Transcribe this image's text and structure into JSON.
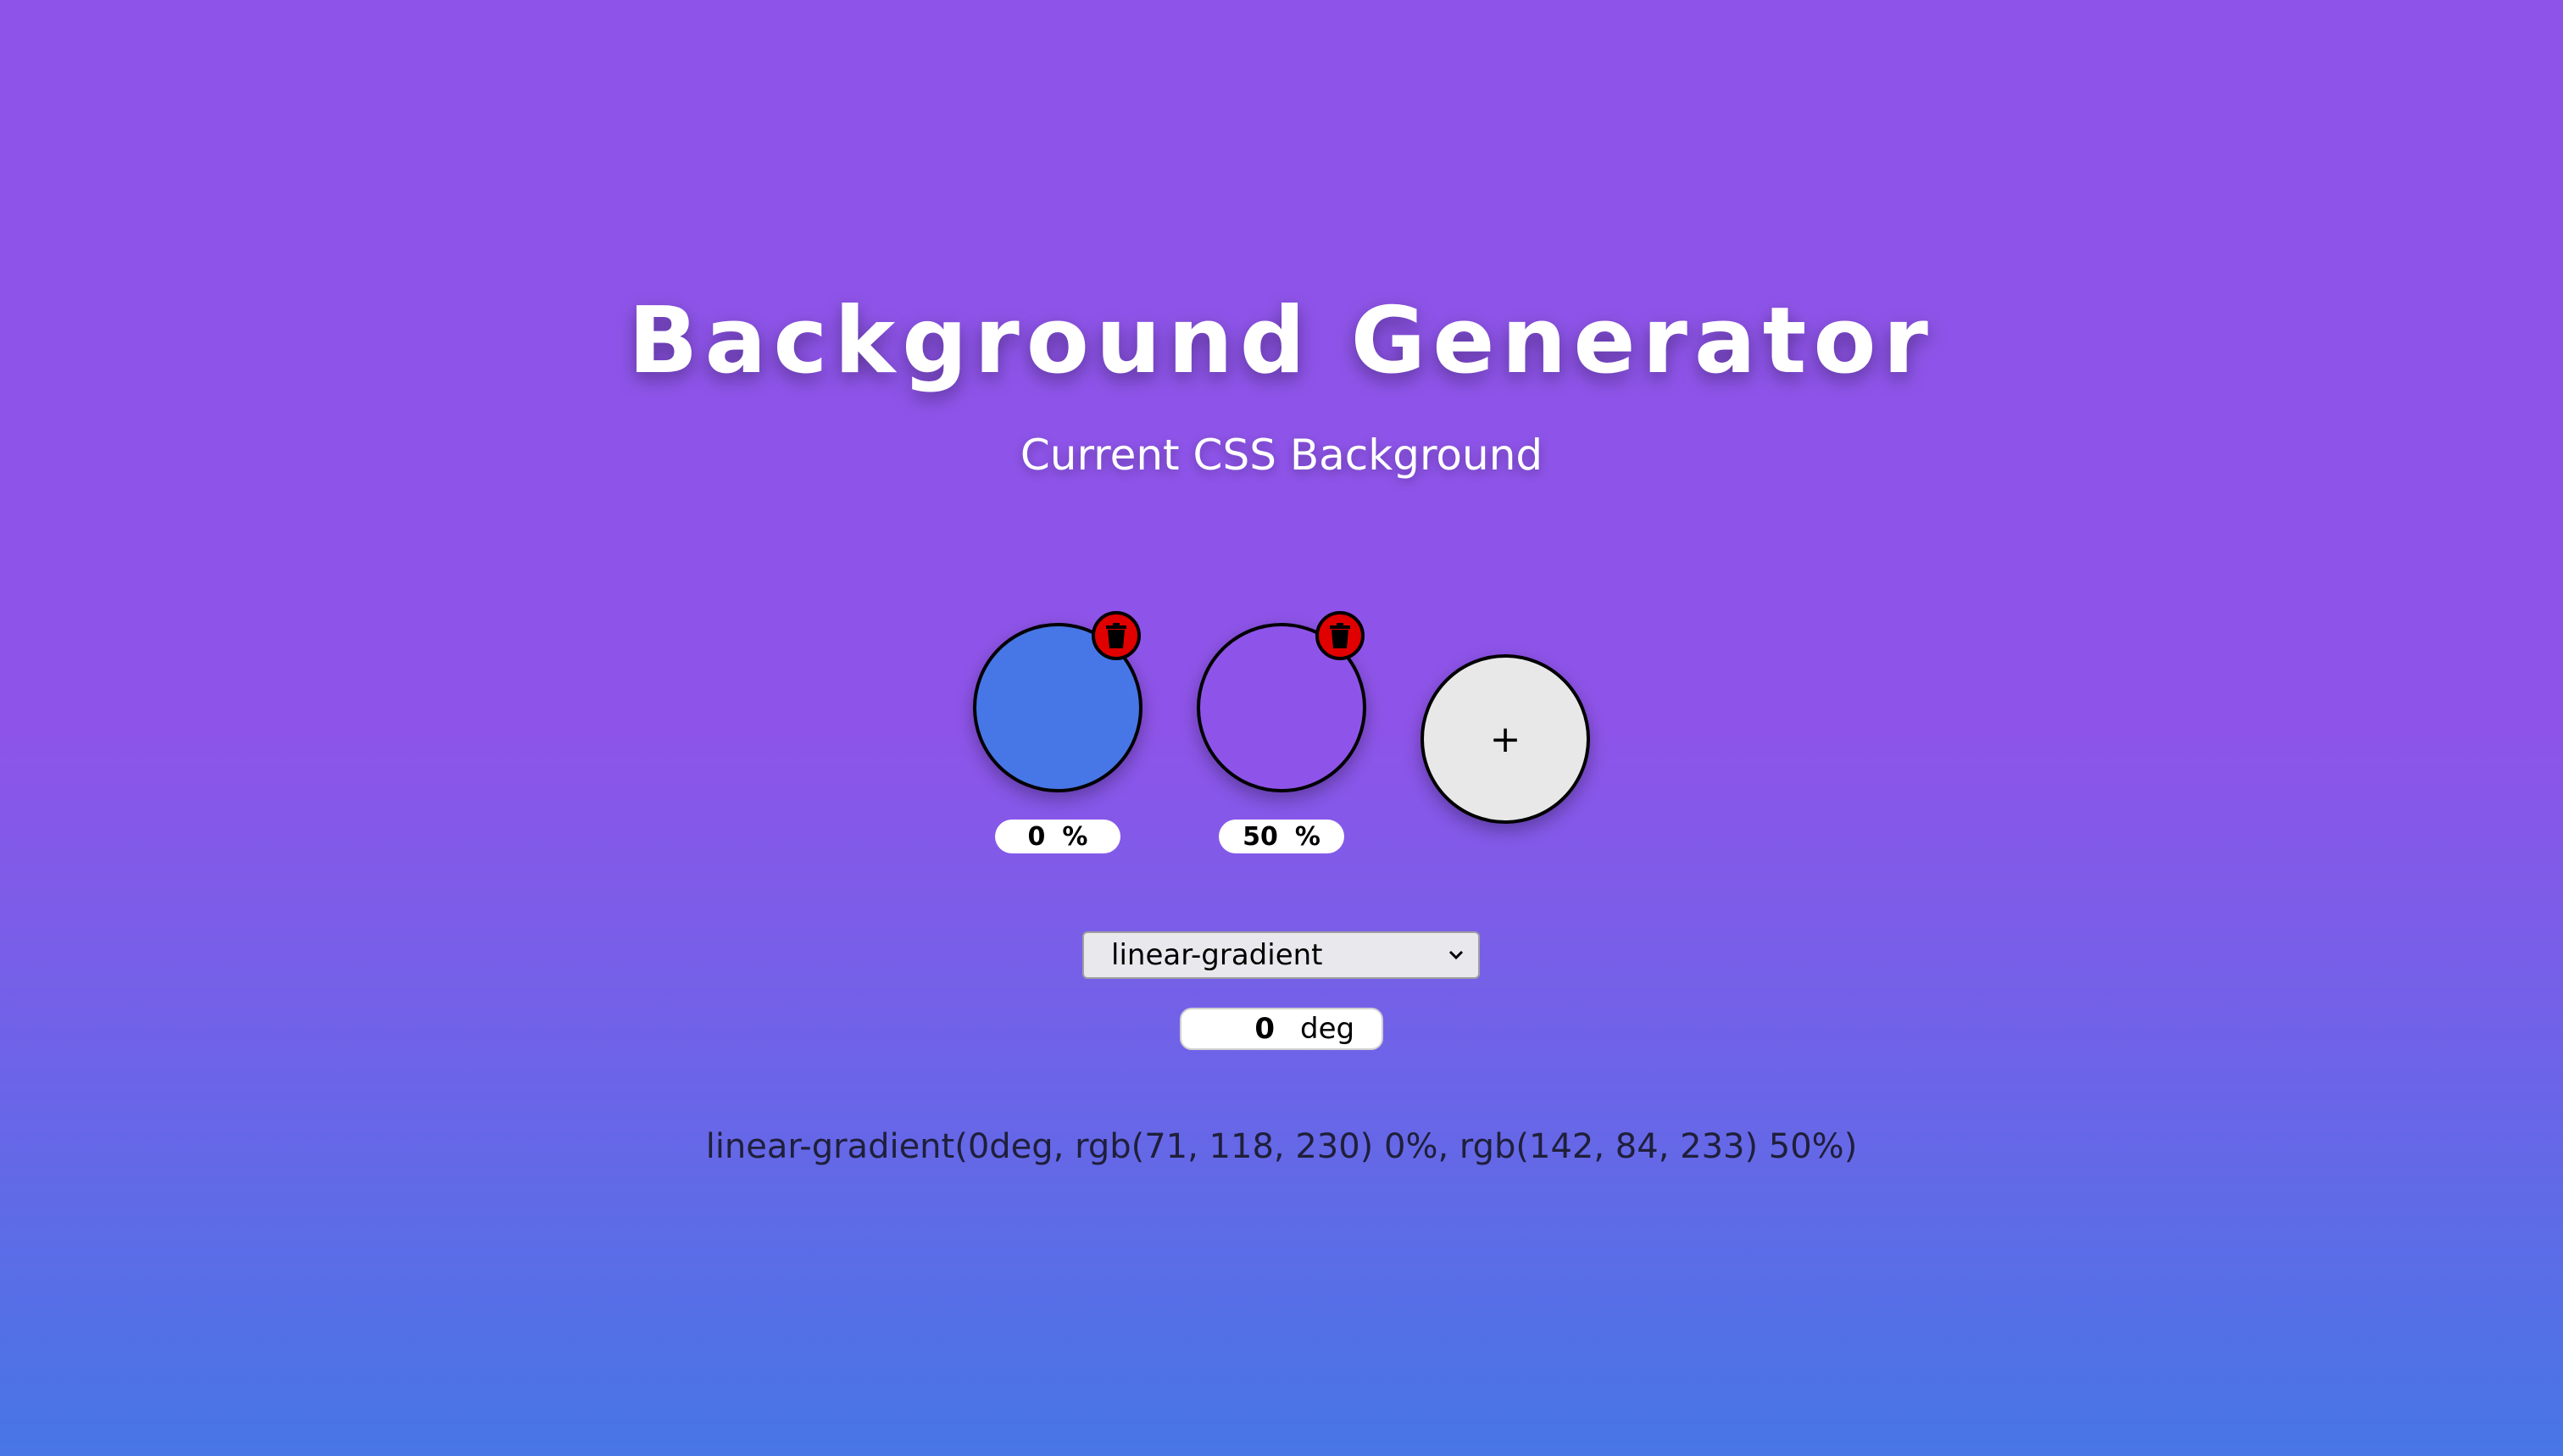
{
  "header": {
    "title": "Background Generator",
    "subtitle": "Current CSS Background"
  },
  "stops": [
    {
      "color": "#4776e6",
      "position": "0",
      "unit": "%",
      "delete_icon": "trash-icon"
    },
    {
      "color": "#8e54e9",
      "position": "50",
      "unit": "%",
      "delete_icon": "trash-icon"
    }
  ],
  "add_button": {
    "label": "+"
  },
  "gradient_type": {
    "selected": "linear-gradient",
    "icon": "chevron-down-icon"
  },
  "angle": {
    "value": "0",
    "unit": "deg"
  },
  "css_output": "linear-gradient(0deg, rgb(71, 118, 230) 0%, rgb(142, 84, 233) 50%)",
  "colors": {
    "gradient_start": "#4776e6",
    "gradient_end": "#8e54e9",
    "delete": "#e00000"
  }
}
